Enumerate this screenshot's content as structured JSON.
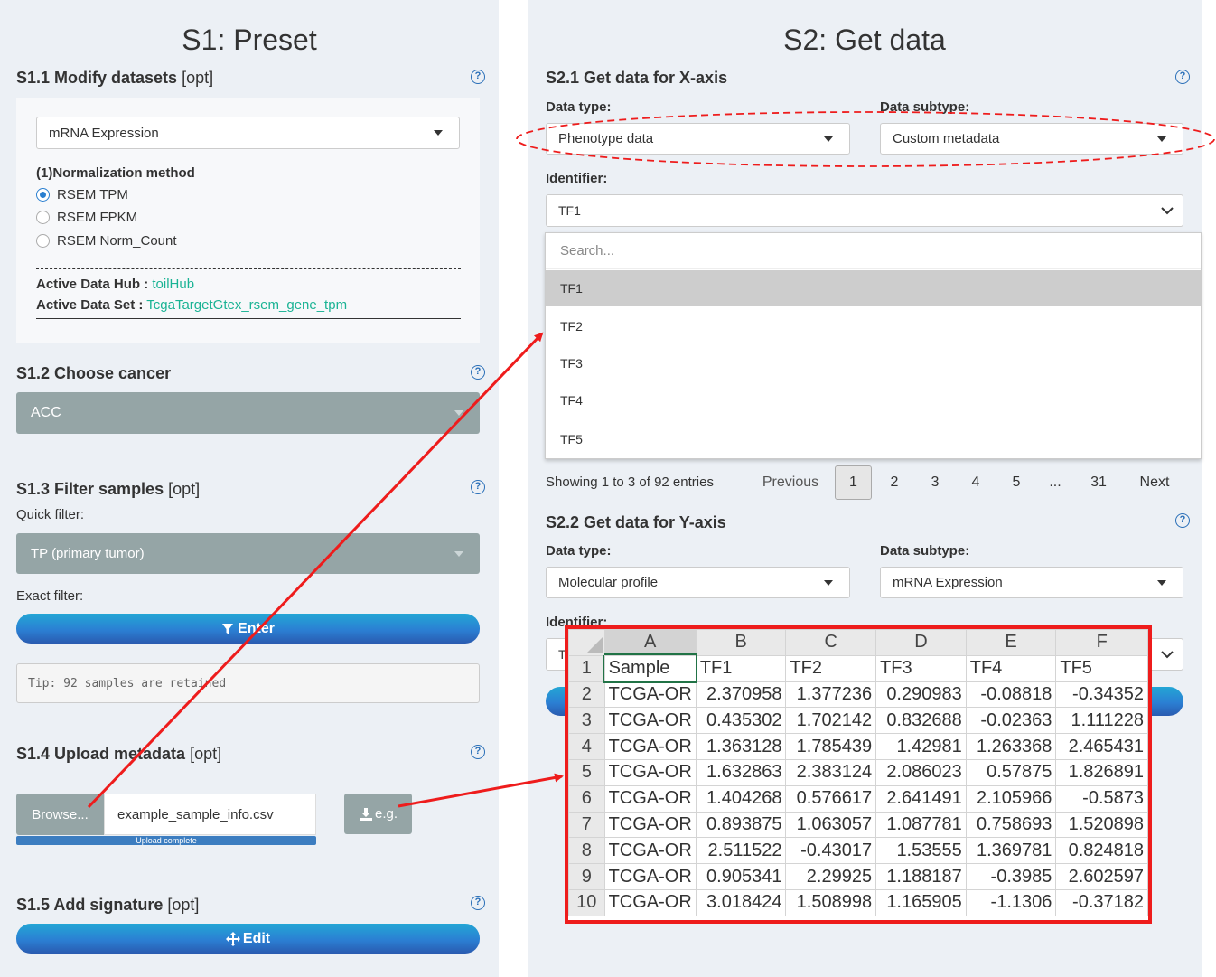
{
  "s1": {
    "title": "S1: Preset",
    "s11": {
      "title": "S1.1 Modify datasets",
      "opt": "[opt]",
      "dataset": "mRNA Expression",
      "norm_label": "(1)Normalization method",
      "radios": [
        "RSEM TPM",
        "RSEM FPKM",
        "RSEM Norm_Count"
      ],
      "hub_label": "Active Data Hub :",
      "hub_value": "toilHub",
      "set_label": "Active Data Set :",
      "set_value": "TcgaTargetGtex_rsem_gene_tpm"
    },
    "s12": {
      "title": "S1.2 Choose cancer",
      "cancer": "ACC"
    },
    "s13": {
      "title": "S1.3 Filter samples",
      "opt": "[opt]",
      "quick_label": "Quick filter:",
      "quick_value": "TP (primary tumor)",
      "exact_label": "Exact filter:",
      "enter_label": "Enter",
      "tip": "Tip: 92 samples are retained"
    },
    "s14": {
      "title": "S1.4 Upload metadata",
      "opt": "[opt]",
      "browse": "Browse...",
      "file": "example_sample_info.csv",
      "progress": "Upload complete",
      "eg": "e.g."
    },
    "s15": {
      "title": "S1.5 Add signature",
      "opt": "[opt]",
      "edit": "Edit"
    }
  },
  "s2": {
    "title": "S2: Get data",
    "s21": {
      "title": "S2.1 Get data for X-axis",
      "type_label": "Data type:",
      "type_value": "Phenotype data",
      "subtype_label": "Data subtype:",
      "subtype_value": "Custom metadata",
      "id_label": "Identifier:",
      "id_value": "TF1",
      "search_placeholder": "Search...",
      "options": [
        "TF1",
        "TF2",
        "TF3",
        "TF4",
        "TF5"
      ]
    },
    "pagination": {
      "info": "Showing 1 to 3 of 92 entries",
      "prev": "Previous",
      "pages": [
        "1",
        "2",
        "3",
        "4",
        "5",
        "...",
        "31"
      ],
      "next": "Next"
    },
    "s22": {
      "title": "S2.2 Get data for Y-axis",
      "type_label": "Data type:",
      "type_value": "Molecular profile",
      "subtype_label": "Data subtype:",
      "subtype_value": "mRNA Expression",
      "id_label": "Identifier:",
      "id_value_partial": "T"
    }
  },
  "spreadsheet": {
    "col_letters": [
      "A",
      "B",
      "C",
      "D",
      "E",
      "F"
    ],
    "rows": [
      [
        "Sample",
        "TF1",
        "TF2",
        "TF3",
        "TF4",
        "TF5"
      ],
      [
        "TCGA-OR",
        "2.370958",
        "1.377236",
        "0.290983",
        "-0.08818",
        "-0.34352"
      ],
      [
        "TCGA-OR",
        "0.435302",
        "1.702142",
        "0.832688",
        "-0.02363",
        "1.111228"
      ],
      [
        "TCGA-OR",
        "1.363128",
        "1.785439",
        "1.42981",
        "1.263368",
        "2.465431"
      ],
      [
        "TCGA-OR",
        "1.632863",
        "2.383124",
        "2.086023",
        "0.57875",
        "1.826891"
      ],
      [
        "TCGA-OR",
        "1.404268",
        "0.576617",
        "2.641491",
        "2.105966",
        "-0.5873"
      ],
      [
        "TCGA-OR",
        "0.893875",
        "1.063057",
        "1.087781",
        "0.758693",
        "1.520898"
      ],
      [
        "TCGA-OR",
        "2.511522",
        "-0.43017",
        "1.53555",
        "1.369781",
        "0.824818"
      ],
      [
        "TCGA-OR",
        "0.905341",
        "2.29925",
        "1.188187",
        "-0.3985",
        "2.602597"
      ],
      [
        "TCGA-OR",
        "3.018424",
        "1.508998",
        "1.165905",
        "-1.1306",
        "-0.37182"
      ]
    ]
  },
  "colors": {
    "annotation_red": "#ee1c1c",
    "link_green": "#1ab394",
    "panel_bg": "#ecf0f5"
  },
  "icons": {
    "help": "question-circle-icon",
    "filter": "filter-icon",
    "download": "download-icon",
    "edit": "arrows-icon"
  }
}
